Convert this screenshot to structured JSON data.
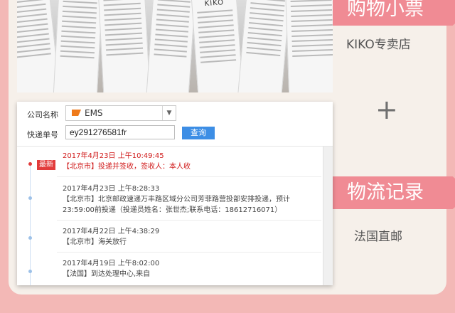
{
  "ribbons": {
    "top": "购物小票",
    "middle": "物流记录"
  },
  "store": "KIKO专卖店",
  "plus": "+",
  "shipping": "法国直邮",
  "form": {
    "company_label": "公司名称",
    "company_value": "EMS",
    "tracking_label": "快递单号",
    "tracking_value": "ey291276581fr",
    "query_button": "查询",
    "newest_badge": "最新"
  },
  "records": [
    {
      "time": "2017年4月23日 上午10:49:45",
      "lines": [
        "【北京市】投递并签收，签收人：本人收"
      ]
    },
    {
      "time": "2017年4月23日 上午8:28:33",
      "lines": [
        "【北京市】北京邮政速递万丰路区域分公司芳菲路营投部安排投递，预计",
        "23:59:00前投递（投递员姓名：张世杰;联系电话：18612716071）"
      ]
    },
    {
      "time": "2017年4月22日 上午4:38:29",
      "lines": [
        "【北京市】海关放行"
      ]
    },
    {
      "time": "2017年4月19日 上午8:02:00",
      "lines": [
        "【法国】到达处理中心,来自"
      ]
    }
  ],
  "photo_receipt_brand": "KIKO",
  "colors": {
    "ribbon": "#f08b94",
    "query_button": "#3d8ee5",
    "latest_record": "#d01a1a"
  }
}
